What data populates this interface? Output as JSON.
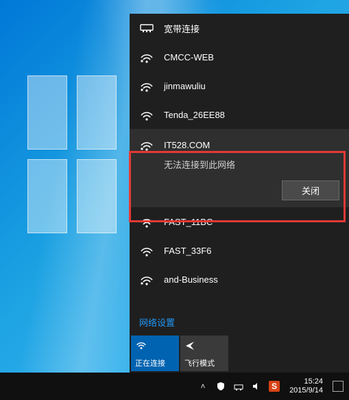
{
  "broadband": {
    "label": "宽带连接"
  },
  "networks": [
    {
      "secured": true,
      "name": "CMCC-WEB"
    },
    {
      "secured": true,
      "name": "jinmawuliu"
    },
    {
      "secured": false,
      "name": "Tenda_26EE88"
    }
  ],
  "selected_network": {
    "name": "IT528.COM",
    "secured": true,
    "status": "无法连接到此网络",
    "close_label": "关闭"
  },
  "networks_after": [
    {
      "secured": false,
      "name": "FAST_11BC"
    },
    {
      "secured": false,
      "name": "FAST_33F6"
    },
    {
      "secured": true,
      "name": "and-Business"
    }
  ],
  "settings_link": "网络设置",
  "tiles": {
    "wifi": {
      "label": "正在连接"
    },
    "airplane": {
      "label": "飞行模式"
    }
  },
  "tray": {
    "ime_badge": "S",
    "time": "15:24",
    "date": "2015/9/14"
  }
}
